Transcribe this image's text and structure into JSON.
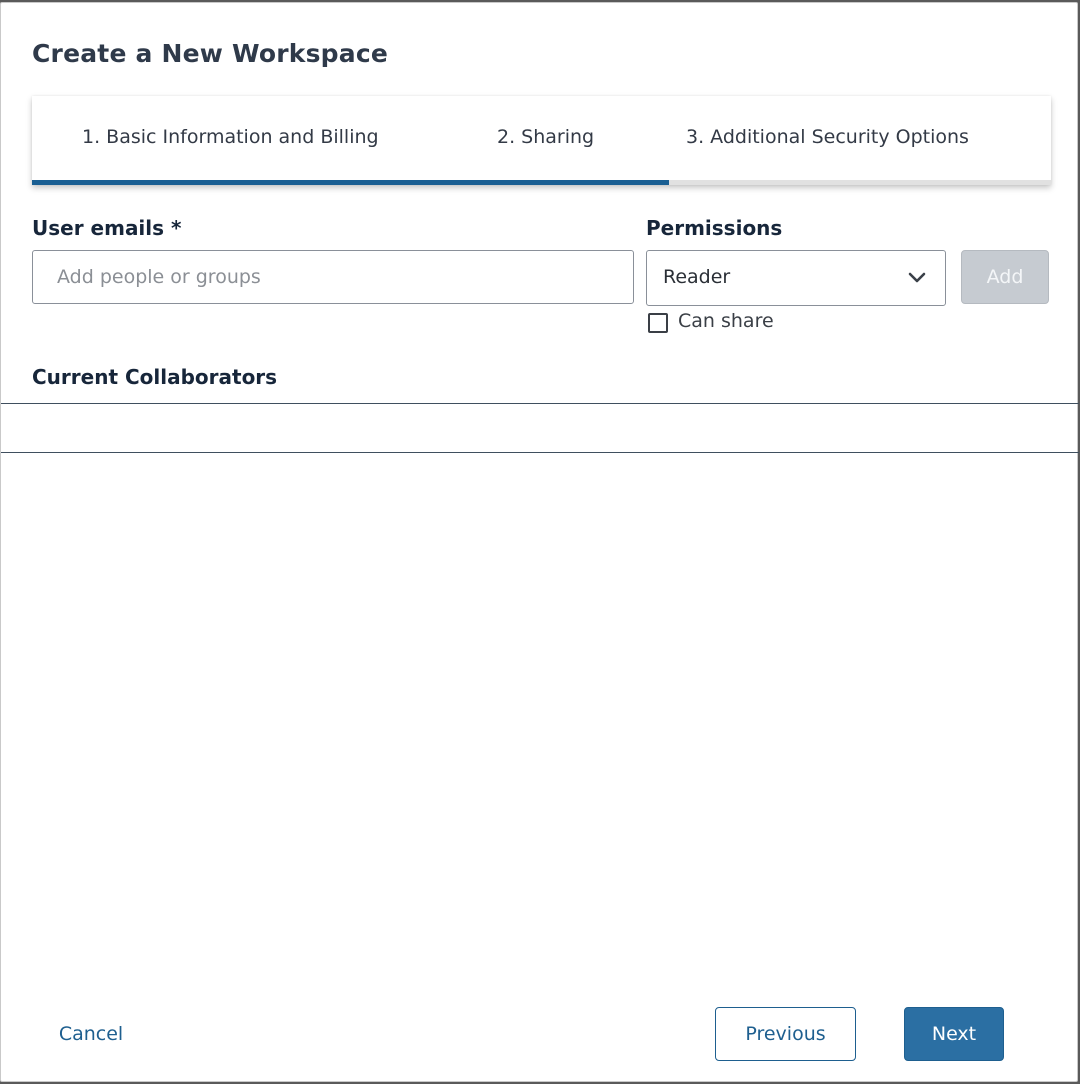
{
  "dialog": {
    "title": "Create a New Workspace"
  },
  "steps": {
    "items": [
      {
        "label": "1. Basic Information and Billing"
      },
      {
        "label": "2. Sharing"
      },
      {
        "label": "3. Additional Security Options"
      }
    ],
    "current_step": 2,
    "progress_fraction": 0.625,
    "progress_color": "#1a5f93"
  },
  "form": {
    "user_emails_label": "User emails *",
    "user_emails_placeholder": "Add people or groups",
    "user_emails_value": "",
    "permissions_label": "Permissions",
    "permissions_selected": "Reader",
    "permissions_icon": "chevron-down-icon",
    "add_button_label": "Add",
    "add_button_enabled": false,
    "can_share_label": "Can share",
    "can_share_checked": false
  },
  "collaborators": {
    "heading": "Current Collaborators",
    "items": []
  },
  "footer": {
    "cancel_label": "Cancel",
    "previous_label": "Previous",
    "next_label": "Next"
  },
  "colors": {
    "primary": "#2b6fa3",
    "link": "#1e5f8f",
    "disabled_button": "#c6cbd1"
  }
}
